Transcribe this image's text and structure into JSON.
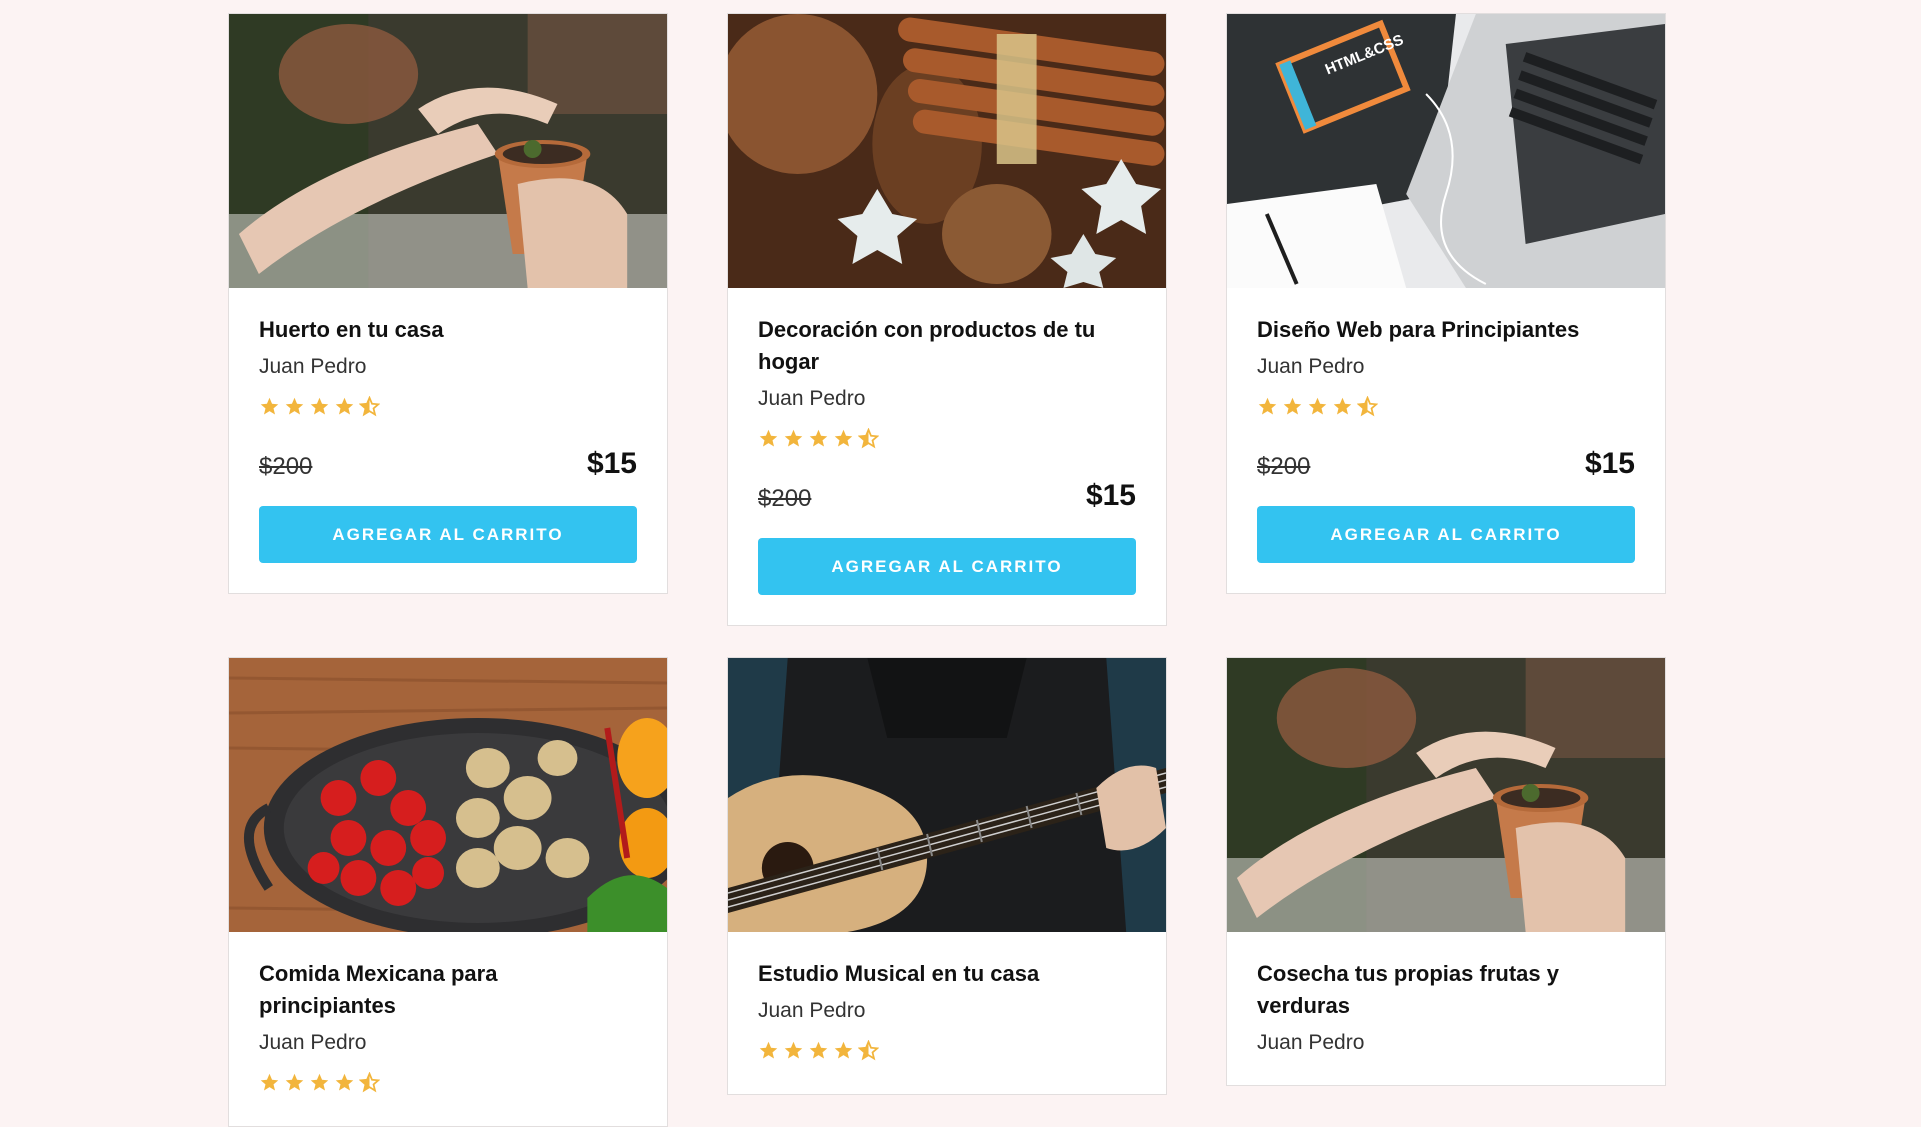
{
  "courses": [
    {
      "title": "Huerto en tu casa",
      "author": "Juan Pedro",
      "rating": 4.5,
      "old_price": "$200",
      "new_price": "$15",
      "button": "AGREGAR AL CARRITO",
      "image": "hands-planting-pot"
    },
    {
      "title": "Decoración con productos de tu hogar",
      "author": "Juan Pedro",
      "rating": 4.5,
      "old_price": "$200",
      "new_price": "$15",
      "button": "AGREGAR AL CARRITO",
      "image": "pinecones-cinnamon-cookies"
    },
    {
      "title": "Diseño Web para Principiantes",
      "author": "Juan Pedro",
      "rating": 4.5,
      "old_price": "$200",
      "new_price": "$15",
      "button": "AGREGAR AL CARRITO",
      "image": "laptop-html-css-book",
      "image_text": "HTML&CSS"
    },
    {
      "title": "Comida Mexicana para principiantes",
      "author": "Juan Pedro",
      "rating": 4.5,
      "image": "pan-tomatoes-mushrooms"
    },
    {
      "title": "Estudio Musical en tu casa",
      "author": "Juan Pedro",
      "rating": 4.5,
      "image": "guitar-player"
    },
    {
      "title": "Cosecha tus propias frutas y verduras",
      "author": "Juan Pedro",
      "rating": 4.5,
      "image": "hands-planting-pot"
    }
  ],
  "colors": {
    "background": "#fcf3f3",
    "button": "#33c3f0",
    "star": "#f2b53c"
  }
}
